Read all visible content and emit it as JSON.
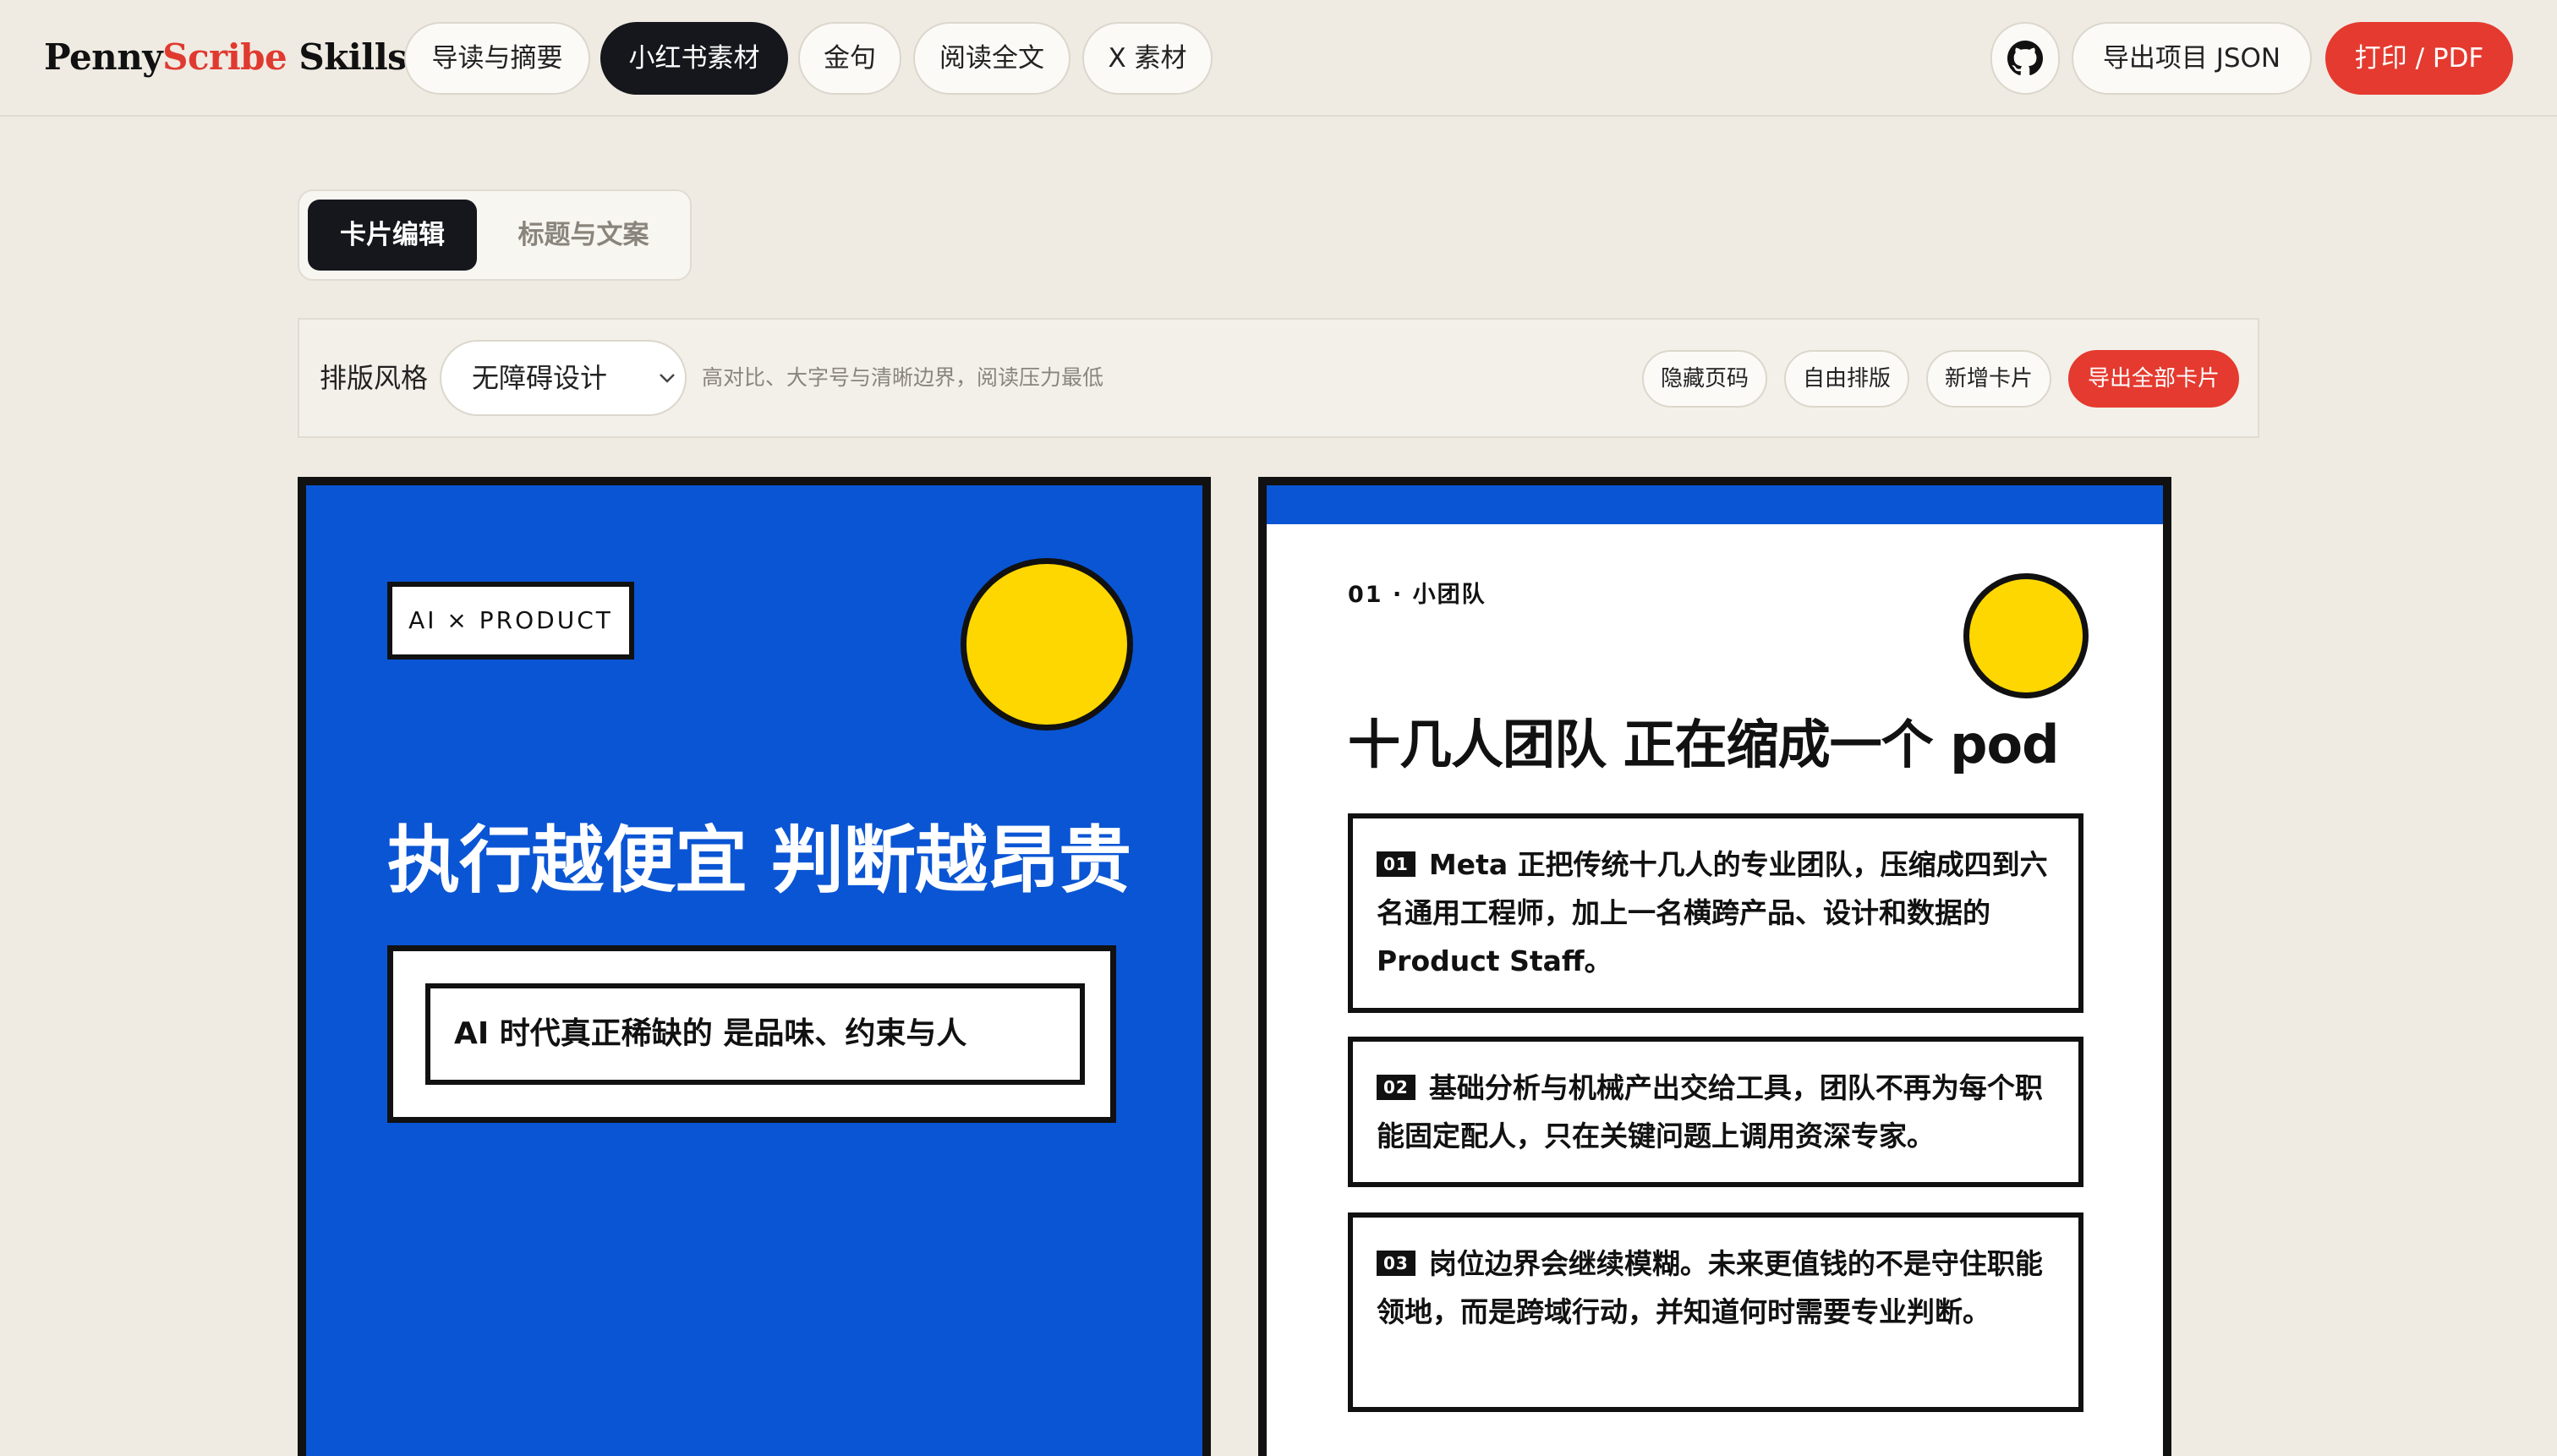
{
  "brand": {
    "part1": "Penny",
    "part2": "Scribe",
    "part3": " Skills"
  },
  "nav": {
    "tabs": [
      {
        "label": "导读与摘要"
      },
      {
        "label": "小红书素材"
      },
      {
        "label": "金句"
      },
      {
        "label": "阅读全文"
      },
      {
        "label": "X 素材"
      }
    ],
    "active_tab": "小红书素材",
    "github_icon": "github-icon",
    "export_json_label": "导出项目 JSON",
    "print_label": "打印 / PDF"
  },
  "subtabs": {
    "active": "卡片编辑",
    "inactive": "标题与文案"
  },
  "toolbar": {
    "style_label": "排版风格",
    "style_value": "无障碍设计",
    "style_desc": "高对比、大字号与清晰边界，阅读压力最低",
    "hide_page_label": "隐藏页码",
    "free_layout_label": "自由排版",
    "add_card_label": "新增卡片",
    "export_all_label": "导出全部卡片"
  },
  "card1": {
    "tag": "AI × PRODUCT",
    "headline": "执行越便宜 判断越昂贵",
    "sub": "AI 时代真正稀缺的 是品味、约束与人"
  },
  "card2": {
    "kicker": "01 · 小团队",
    "title": "十几人团队 正在缩成一个 pod",
    "items": [
      {
        "num": "01",
        "text": "Meta 正把传统十几人的专业团队，压缩成四到六名通用工程师，加上一名横跨产品、设计和数据的 Product Staff。"
      },
      {
        "num": "02",
        "text": "基础分析与机械产出交给工具，团队不再为每个职能固定配人，只在关键问题上调用资深专家。"
      },
      {
        "num": "03",
        "text": "岗位边界会继续模糊。未来更值钱的不是守住职能领地，而是跨域行动，并知道何时需要专业判断。"
      }
    ]
  },
  "colors": {
    "accent_red": "#e53a2f",
    "blue": "#0a55d4",
    "yellow": "#ffd700",
    "dark": "#15171c",
    "background": "#efebe3"
  }
}
